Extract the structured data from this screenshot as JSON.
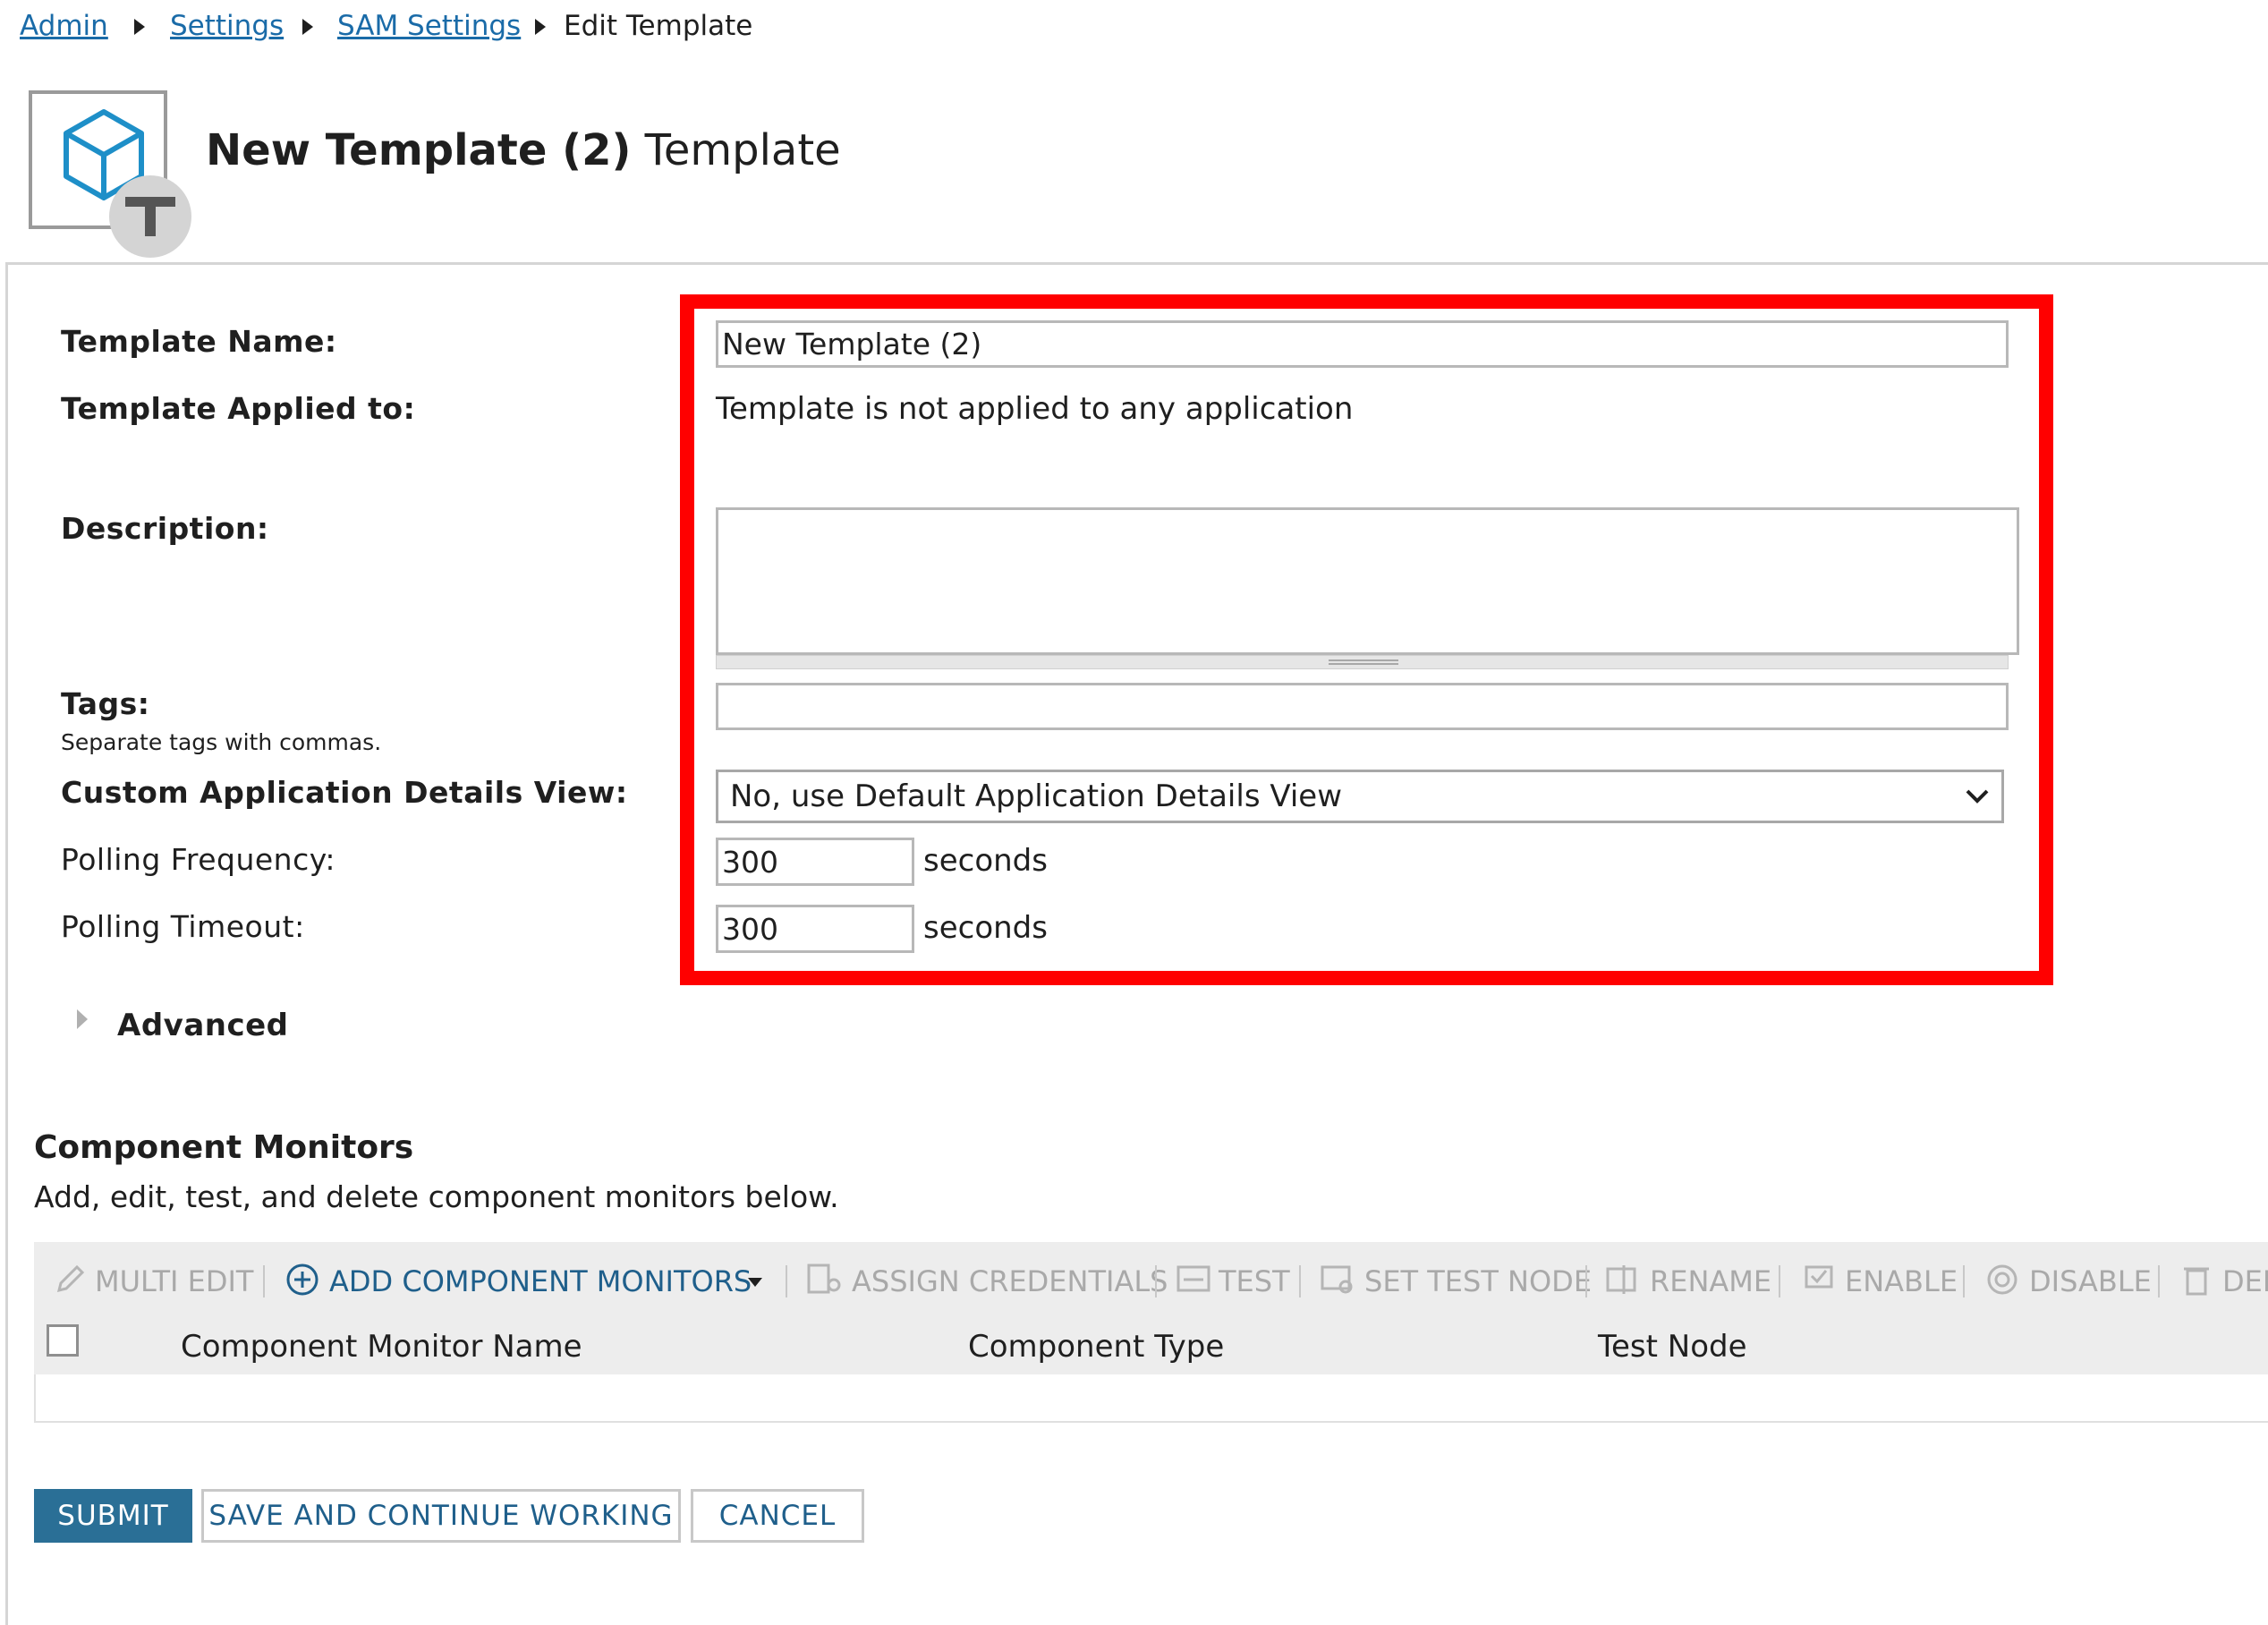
{
  "breadcrumb": {
    "items": [
      "Admin",
      "Settings",
      "SAM Settings"
    ],
    "current": "Edit Template"
  },
  "header": {
    "title_bold": "New Template (2)",
    "title_rest": " Template",
    "icon": "template-cube-icon"
  },
  "form": {
    "template_name_label": "Template Name:",
    "template_name_value": "New Template (2)",
    "applied_label": "Template Applied to:",
    "applied_value": "Template is not applied to any application",
    "description_label": "Description:",
    "description_value": "",
    "tags_label": "Tags:",
    "tags_hint": "Separate tags with commas.",
    "tags_value": "",
    "custom_view_label": "Custom Application Details View:",
    "custom_view_value": "No, use Default Application Details View",
    "polling_frequency_label": "Polling Frequency:",
    "polling_frequency_value": "300",
    "polling_timeout_label": "Polling Timeout:",
    "polling_timeout_value": "300",
    "seconds_unit": "seconds",
    "advanced_label": "Advanced"
  },
  "component_monitors": {
    "title": "Component Monitors",
    "subtitle": "Add, edit, test, and delete component monitors below.",
    "toolbar": {
      "multi_edit": "MULTI EDIT",
      "add": "ADD COMPONENT MONITORS",
      "assign_credentials": "ASSIGN CREDENTIALS",
      "test": "TEST",
      "set_test_node": "SET TEST NODE",
      "rename": "RENAME",
      "enable": "ENABLE",
      "disable": "DISABLE",
      "delete": "DEL"
    },
    "columns": [
      "Component Monitor Name",
      "Component Type",
      "Test Node"
    ]
  },
  "actions": {
    "submit": "SUBMIT",
    "save_continue": "SAVE AND CONTINUE WORKING",
    "cancel": "CANCEL"
  },
  "colors": {
    "link": "#1a6ba8",
    "highlight": "#ff0000",
    "primary_button": "#2a6f96",
    "toolbar_bg": "#ededed"
  }
}
